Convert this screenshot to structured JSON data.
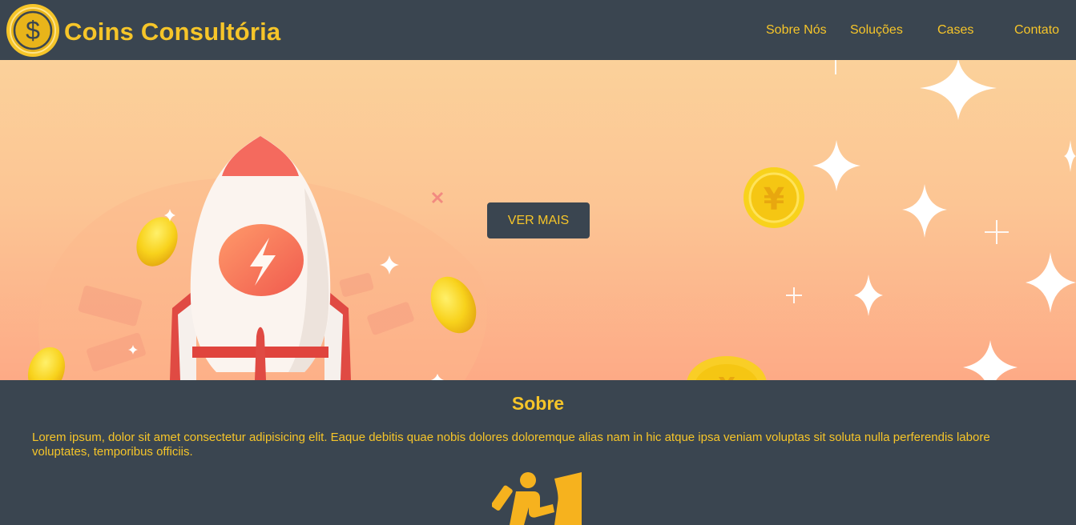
{
  "header": {
    "brand": "Coins Consultória",
    "logo_icon": "dollar-coin-icon",
    "nav": [
      {
        "label": "Sobre Nós"
      },
      {
        "label": "Soluções"
      },
      {
        "label": "Cases"
      },
      {
        "label": "Contato"
      }
    ]
  },
  "hero": {
    "cta_label": "VER MAIS",
    "illustration": "rocket-with-coins-illustration"
  },
  "about": {
    "title": "Sobre",
    "text": "Lorem ipsum, dolor sit amet consectetur adipisicing elit. Eaque debitis quae nobis dolores doloremque alias nam in hic atque ipsa veniam voluptas sit soluta nulla perferendis labore voluptates, temporibus officiis.",
    "icon": "climbing-person-icon"
  },
  "colors": {
    "accent": "#f6c529",
    "dark": "#3a4550",
    "hero_top": "#fbd19a",
    "hero_bottom": "#fdaa86",
    "rocket_red": "#f26b5b"
  }
}
